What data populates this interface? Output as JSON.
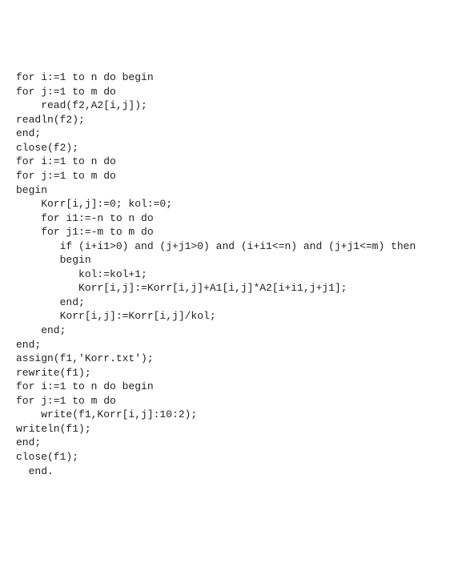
{
  "code": {
    "lines": [
      "for i:=1 to n do begin",
      "for j:=1 to m do",
      "    read(f2,A2[i,j]);",
      "readln(f2);",
      "end;",
      "close(f2);",
      "for i:=1 to n do",
      "for j:=1 to m do",
      "begin",
      "    Korr[i,j]:=0; kol:=0;",
      "    for i1:=-n to n do",
      "    for j1:=-m to m do",
      "       if (i+i1>0) and (j+j1>0) and (i+i1<=n) and (j+j1<=m) then",
      "       begin",
      "          kol:=kol+1;",
      "          Korr[i,j]:=Korr[i,j]+A1[i,j]*A2[i+i1,j+j1];",
      "       end;",
      "       Korr[i,j]:=Korr[i,j]/kol;",
      "    end;",
      "end;",
      "assign(f1,'Korr.txt');",
      "rewrite(f1);",
      "for i:=1 to n do begin",
      "for j:=1 to m do",
      "    write(f1,Korr[i,j]:10:2);",
      "writeln(f1);",
      "end;",
      "close(f1);",
      "  end."
    ]
  }
}
